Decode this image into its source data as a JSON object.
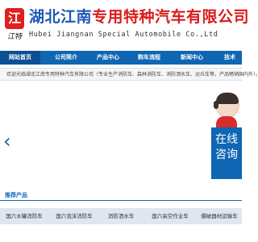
{
  "logo": {
    "mark": "江",
    "script_text": "江特"
  },
  "company": {
    "name_prefix": "湖北江南",
    "name_rest": "专用特种汽车有限公司",
    "name_en": "Hubei Jiangnan Special Automobile Co.,Ltd"
  },
  "nav": {
    "items": [
      {
        "label": "网站首页",
        "active": true
      },
      {
        "label": "公司简介"
      },
      {
        "label": "产品中心"
      },
      {
        "label": "购车流程"
      },
      {
        "label": "新闻中心"
      },
      {
        "label": "技术"
      }
    ]
  },
  "notice": {
    "text": "欢迎光临湖北江南专用特种汽车有限公司（专业生产消防车、森林消防车、消防洒水车、运兵车等，产品畅销国内外）。"
  },
  "carousel": {
    "prev_symbol": "‹"
  },
  "service": {
    "label_line1": "在线",
    "label_line2": "咨询"
  },
  "products": {
    "section_title": "推荐产品",
    "items": [
      {
        "label": "国六水罐消防车"
      },
      {
        "label": "国六泡沫消防车"
      },
      {
        "label": "消防洒水车"
      },
      {
        "label": "国六高空作业车"
      },
      {
        "label": "爆破器材运输车"
      }
    ]
  },
  "colors": {
    "brand_red": "#d91c1c",
    "brand_blue": "#0f66b2"
  }
}
